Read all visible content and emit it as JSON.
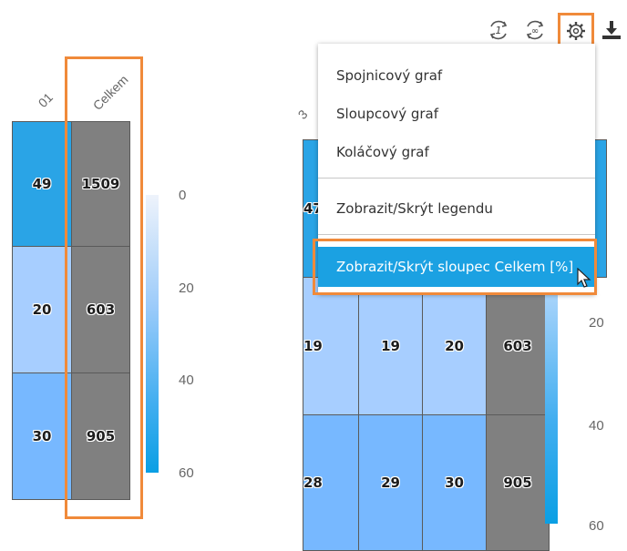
{
  "left_panel": {
    "column_headers": [
      "01",
      "Celkem"
    ],
    "rows": [
      [
        "49",
        "1509"
      ],
      [
        "20",
        "603"
      ],
      [
        "30",
        "905"
      ]
    ],
    "colorbar_ticks": [
      "0",
      "20",
      "40",
      "60"
    ]
  },
  "right_panel": {
    "partial_header": "3",
    "rows": [
      [
        "47",
        "",
        "",
        ""
      ],
      [
        "19",
        "19",
        "20",
        "603"
      ],
      [
        "28",
        "29",
        "30",
        "905"
      ]
    ],
    "colorbar_ticks": [
      "20",
      "40",
      "60"
    ]
  },
  "toolbar": {
    "buttons": [
      {
        "name": "rotate-1-icon",
        "glyph": "1"
      },
      {
        "name": "rotate-infinity-icon",
        "glyph": "∞"
      },
      {
        "name": "gear-icon",
        "glyph": "⚙"
      },
      {
        "name": "download-icon",
        "glyph": ""
      }
    ]
  },
  "menu": {
    "items": [
      "Spojnicový graf",
      "Sloupcový graf",
      "Koláčový graf",
      "Zobrazit/Skrýt legendu",
      "Zobrazit/Skrýt sloupec Celkem [%]"
    ],
    "highlighted_index": 4
  },
  "colors": {
    "accent_orange": "#f08a3a",
    "highlight_blue": "#1ba1e2",
    "total_gray": "#808080",
    "cell_dark_blue": "#2aa4e6",
    "cell_light_blue": "#a7ceff",
    "cell_mid_blue": "#77b8ff"
  }
}
